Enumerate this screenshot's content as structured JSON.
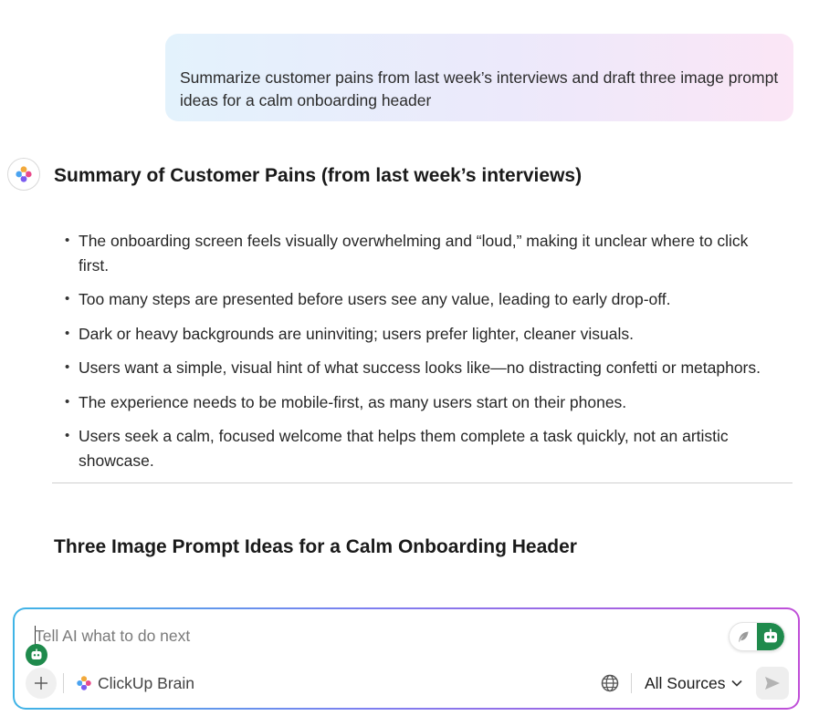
{
  "conversation": {
    "user_message": "Summarize customer pains from last week’s interviews and draft three image prompt ideas for a calm onboarding header",
    "assistant": {
      "summary_heading": "Summary of Customer Pains (from last week’s interviews)",
      "pains": [
        "The onboarding screen feels visually overwhelming and “loud,” making it unclear where to click first.",
        "Too many steps are presented before users see any value, leading to early drop-off.",
        "Dark or heavy backgrounds are uninviting; users prefer lighter, cleaner visuals.",
        "Users want a simple, visual hint of what success looks like—no distracting confetti or metaphors.",
        "The experience needs to be mobile-first, as many users start on their phones.",
        "Users seek a calm, focused welcome that helps them complete a task quickly, not an artistic showcase."
      ],
      "prompts_heading": "Three Image Prompt Ideas for a Calm Onboarding Header"
    }
  },
  "composer": {
    "placeholder": "Tell AI what to do next",
    "brain_label": "ClickUp Brain",
    "sources_label": "All Sources",
    "icons": {
      "add": "plus-icon",
      "brain": "clickup-brain-icon",
      "globe": "globe-icon",
      "chevron": "chevron-down-icon",
      "send": "send-icon",
      "feather": "feather-icon",
      "bot": "robot-icon"
    }
  },
  "colors": {
    "agent_green": "#1f8a4c",
    "bubble_gradient_start": "#e3f2fc",
    "bubble_gradient_end": "#fbe6f6",
    "composer_border_start": "#3fb4e6",
    "composer_border_end": "#c04fd8"
  }
}
